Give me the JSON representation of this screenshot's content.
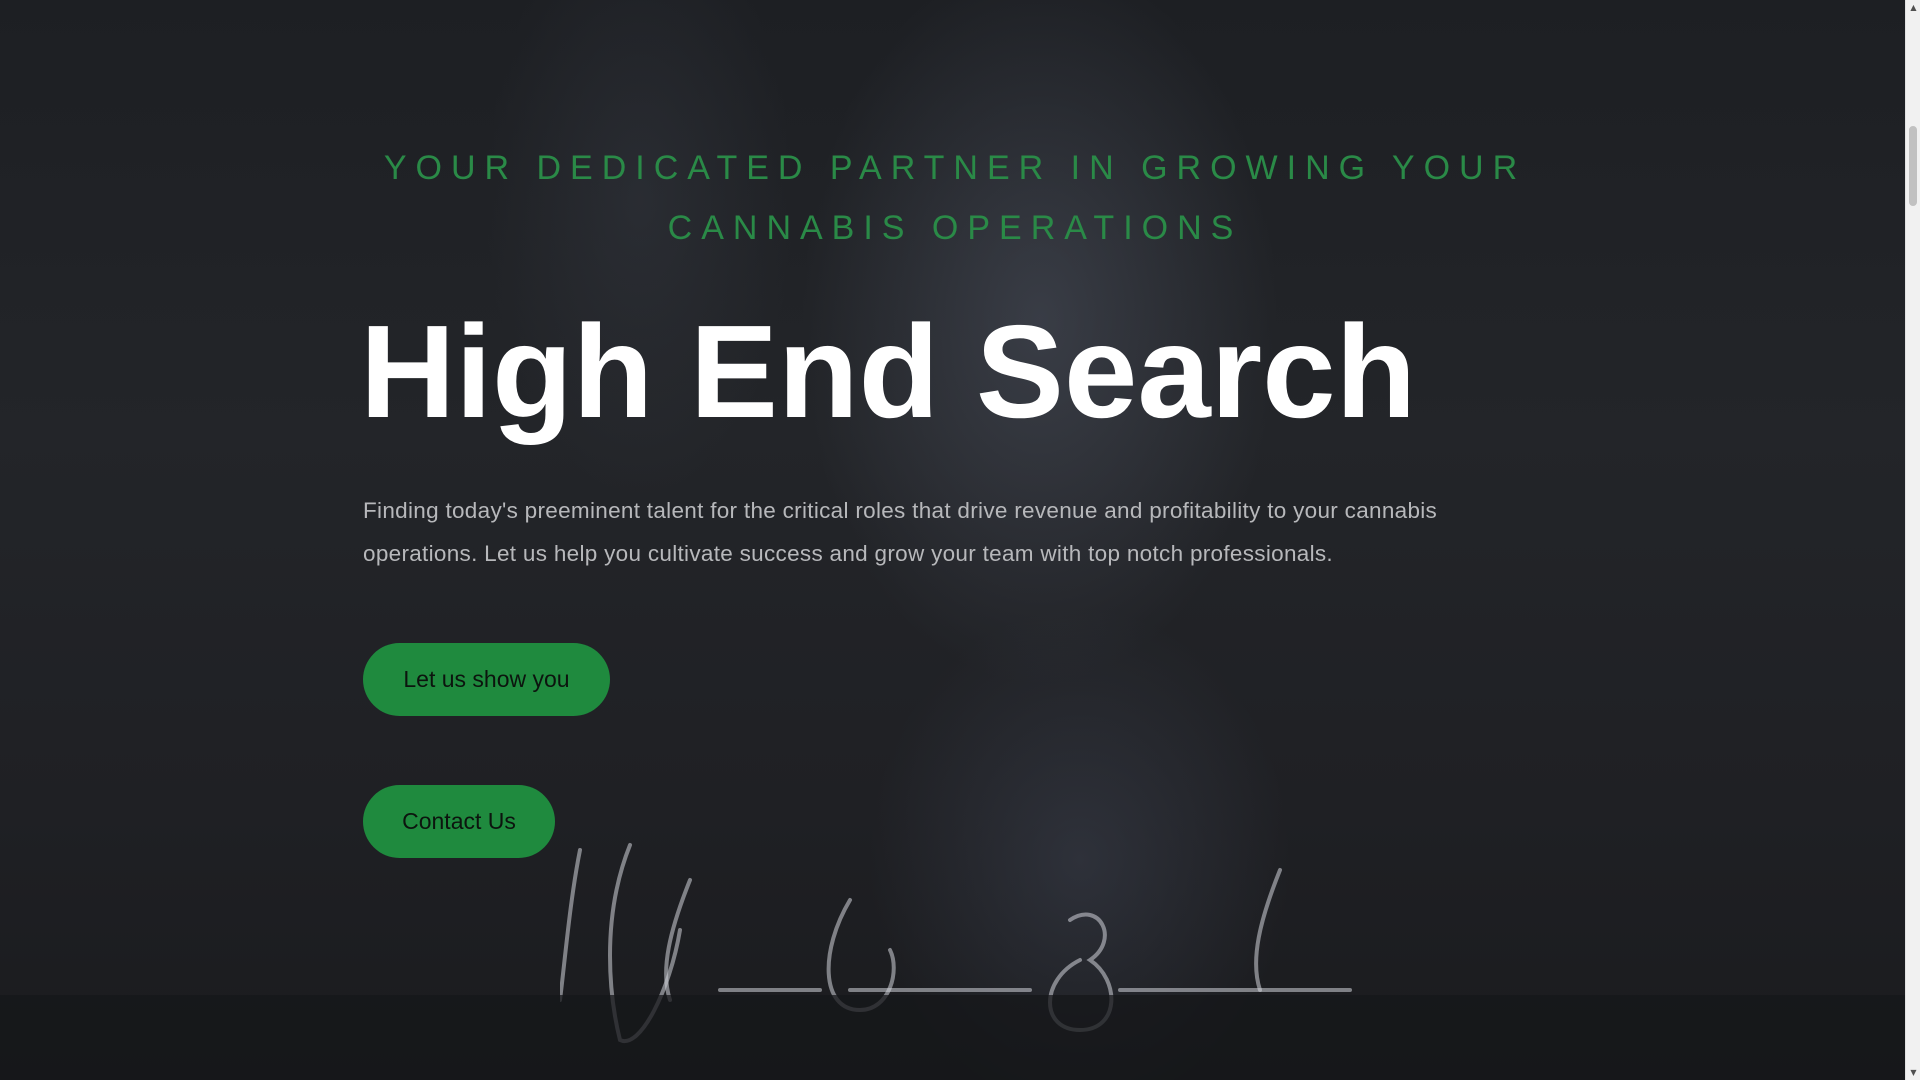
{
  "hero": {
    "tagline": "YOUR DEDICATED PARTNER IN GROWING YOUR CANNABIS OPERATIONS",
    "title": "High End Search",
    "description": "Finding today's preeminent talent for the critical roles that drive revenue and profitability to your cannabis operations. Let us help you cultivate success and grow your team with top notch professionals.",
    "primary_button_label": "Let us show you",
    "contact_button_label": "Contact Us"
  },
  "colors": {
    "accent_green": "#1f8a3e",
    "tagline_green": "#2a8a47",
    "title_white": "#ffffff",
    "body_text_grey": "#b7b8bb",
    "background_dark": "#1f2024"
  },
  "icons": {
    "scroll_up": "triangle-up-icon",
    "scroll_down": "triangle-down-icon"
  }
}
